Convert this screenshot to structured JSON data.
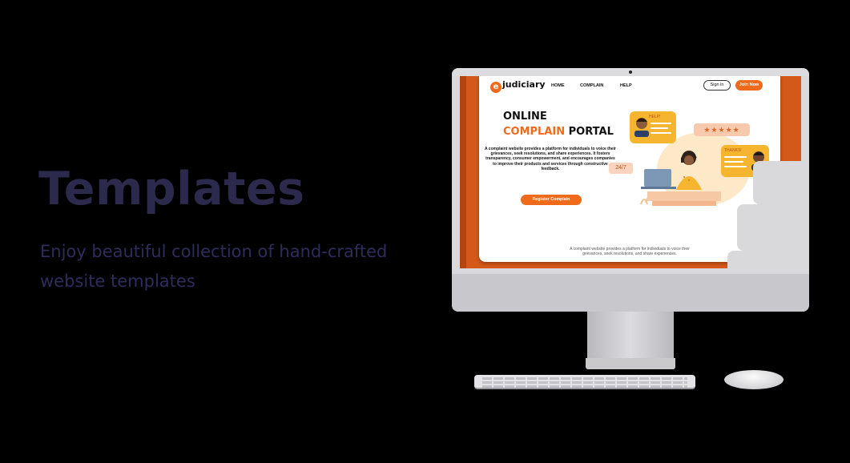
{
  "hero": {
    "title": "Templates",
    "subtitle": "Enjoy beautiful collection of hand-crafted website templates"
  },
  "site": {
    "logo_letter": "e",
    "logo_text": "judiciary",
    "nav": [
      "HOME",
      "COMPLAIN",
      "HELP"
    ],
    "signin_label": "Sign in",
    "join_label": "Join Now",
    "heading_line1": "ONLINE",
    "heading_complain": "COMPLAIN",
    "heading_portal": "PORTAL",
    "description": "A complaint website provides a platform for individuals to voice their grievances, seek resolutions, and share experiences. It fosters transparency, consumer empowerment, and encourages companies to improve their products and services through constructive feedback.",
    "register_label": "Register Complain",
    "footer_text": "A complaint website provides a platform for individuals to voice their grievances, seek resolutions, and share experiences.",
    "help_label": "HELP!",
    "thanks_label": "THANKS!",
    "rating_stars": "★★★★★",
    "availability": "24/7"
  },
  "colors": {
    "accent": "#f06a1c",
    "hero_text": "#2b2a4c",
    "screen_bg": "#d4581a"
  },
  "icons": [
    "keyboard",
    "mouse",
    "headset-agent",
    "laptop",
    "user-avatar",
    "star"
  ]
}
